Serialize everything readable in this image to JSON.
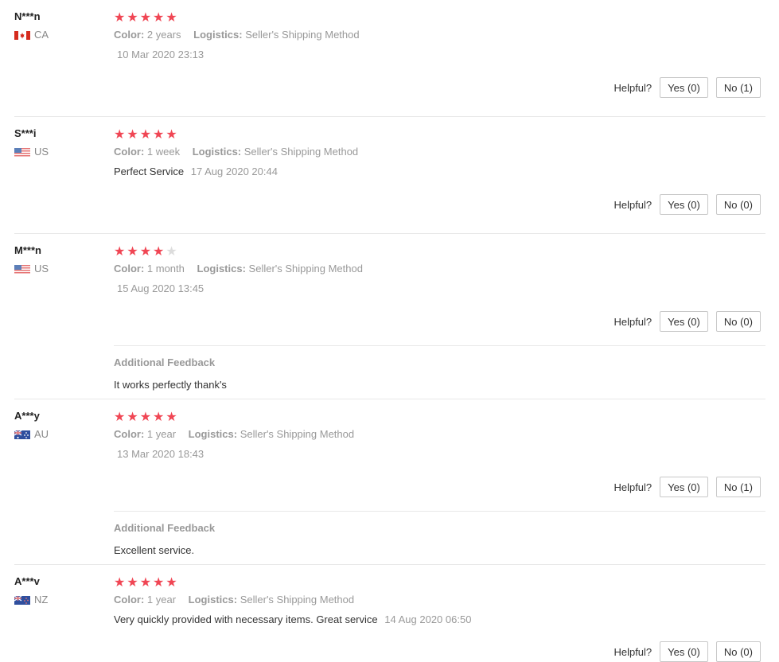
{
  "labels": {
    "color": "Color:",
    "logistics": "Logistics:",
    "helpful": "Helpful?",
    "additional_feedback": "Additional Feedback"
  },
  "colors": {
    "star": "#f04654",
    "star_empty": "#dcdcdc"
  },
  "reviews": [
    {
      "user": "N***n",
      "country": "CA",
      "flag_icon": "canada-flag-icon",
      "rating": 5,
      "color": "2 years",
      "logistics": "Seller's Shipping Method",
      "text": "",
      "date": "10 Mar 2020 23:13",
      "yes": "Yes (0)",
      "no": "No (1)"
    },
    {
      "user": "S***i",
      "country": "US",
      "flag_icon": "usa-flag-icon",
      "rating": 5,
      "color": "1 week",
      "logistics": "Seller's Shipping Method",
      "text": "Perfect Service",
      "date": "17 Aug 2020 20:44",
      "yes": "Yes (0)",
      "no": "No (0)"
    },
    {
      "user": "M***n",
      "country": "US",
      "flag_icon": "usa-flag-icon",
      "rating": 4,
      "color": "1 month",
      "logistics": "Seller's Shipping Method",
      "text": "",
      "date": "15 Aug 2020 13:45",
      "yes": "Yes (0)",
      "no": "No (0)",
      "additional": "It works perfectly thank's"
    },
    {
      "user": "A***y",
      "country": "AU",
      "flag_icon": "australia-flag-icon",
      "rating": 5,
      "color": "1 year",
      "logistics": "Seller's Shipping Method",
      "text": "",
      "date": "13 Mar 2020 18:43",
      "yes": "Yes (0)",
      "no": "No (1)",
      "additional": "Excellent service."
    },
    {
      "user": "A***v",
      "country": "NZ",
      "flag_icon": "new-zealand-flag-icon",
      "rating": 5,
      "color": "1 year",
      "logistics": "Seller's Shipping Method",
      "text": "Very quickly provided with necessary items. Great service",
      "date": "14 Aug 2020 06:50",
      "yes": "Yes (0)",
      "no": "No (0)"
    }
  ]
}
